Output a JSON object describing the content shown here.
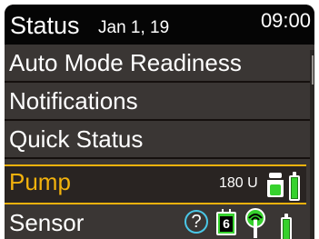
{
  "header": {
    "title": "Status",
    "date": "Jan 1, 19",
    "time": "09:00"
  },
  "menu": {
    "items": [
      {
        "label": "Auto Mode Readiness"
      },
      {
        "label": "Notifications"
      },
      {
        "label": "Quick Status"
      },
      {
        "label": "Pump"
      },
      {
        "label": "Sensor"
      }
    ],
    "selected_index": 3
  },
  "pump": {
    "reservoir_units": "180 U",
    "battery_level": 1.0,
    "reservoir_icon": "reservoir-icon",
    "battery_icon": "battery-icon"
  },
  "sensor": {
    "help_symbol": "?",
    "calibration_days": "6",
    "connection_icon": "sensor-connection-icon",
    "battery_level": 1.0
  },
  "colors": {
    "accent": "#f2b20d",
    "status_green": "#36d12d",
    "help_blue": "#4ac6e6",
    "background": "#3a3634",
    "header": "#050505"
  }
}
